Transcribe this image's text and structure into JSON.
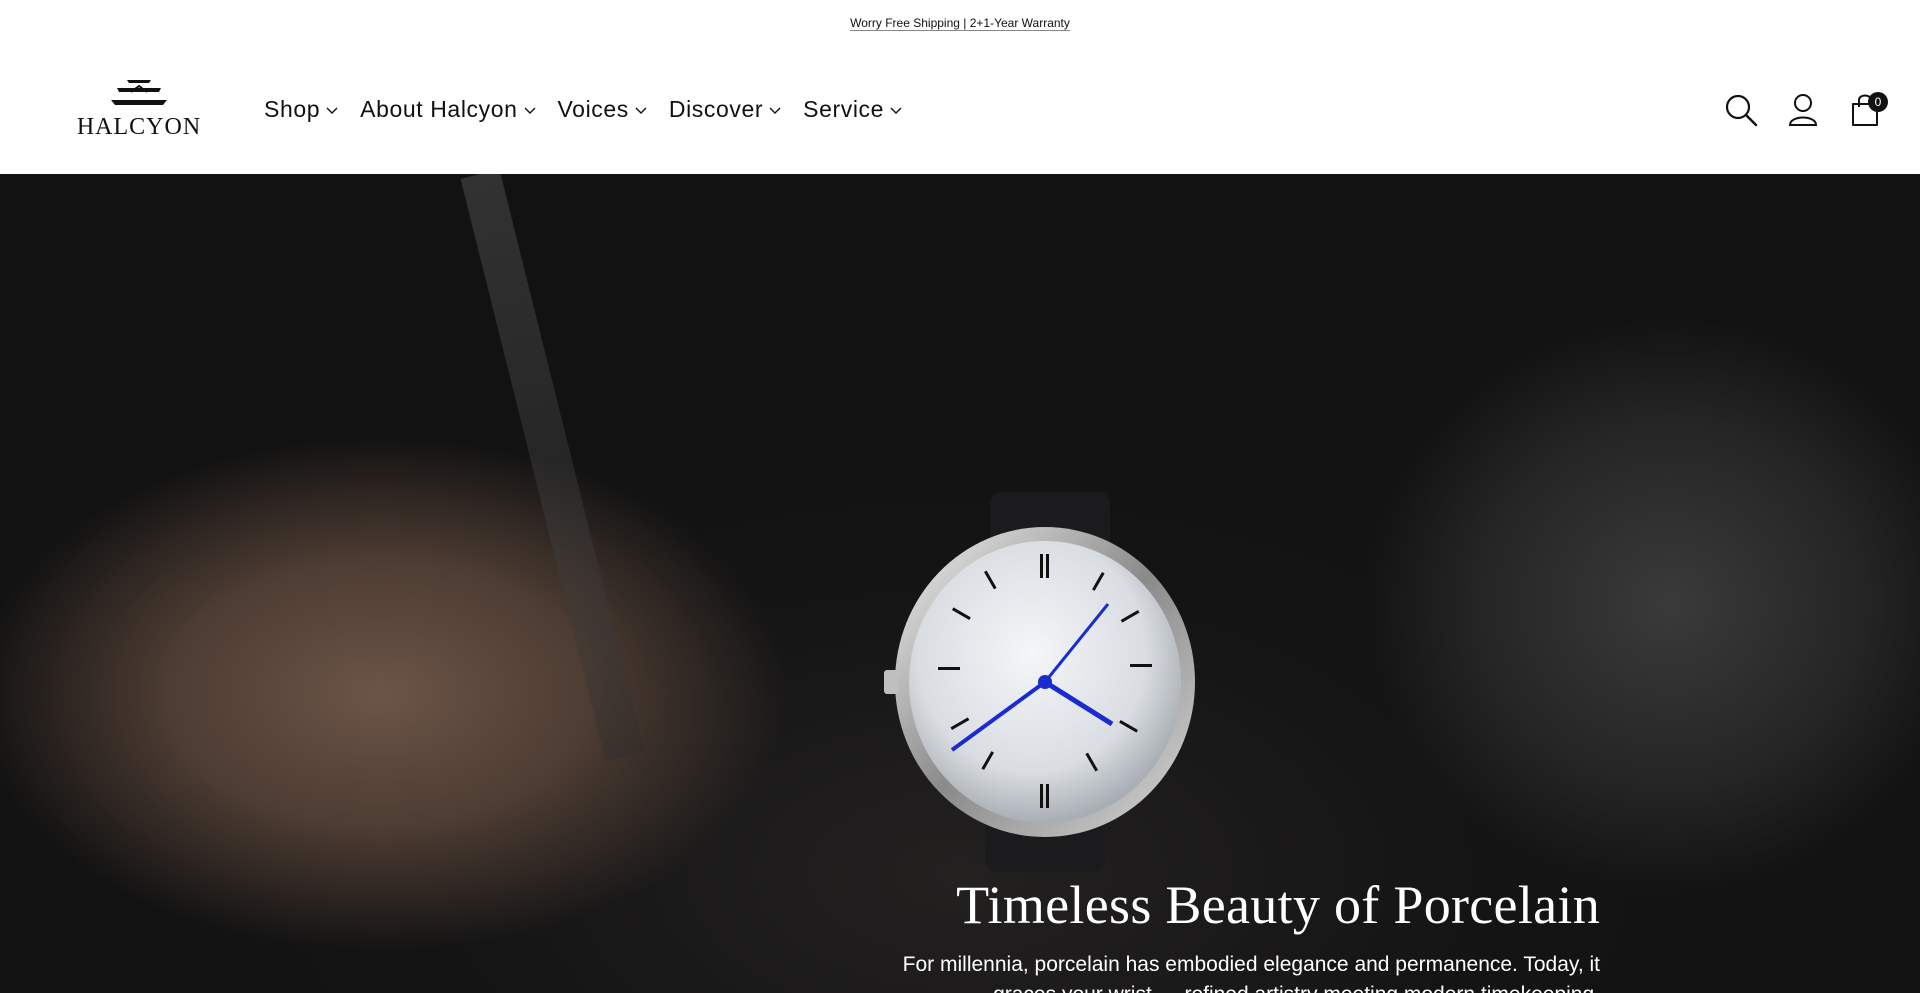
{
  "announcement": {
    "text": "Worry Free Shipping | 2+1-Year Warranty"
  },
  "brand": {
    "name": "HALCYON"
  },
  "nav": {
    "items": [
      {
        "label": "Shop"
      },
      {
        "label": "About Halcyon"
      },
      {
        "label": "Voices"
      },
      {
        "label": "Discover"
      },
      {
        "label": "Service"
      }
    ]
  },
  "header_icons": {
    "search": "search-icon",
    "account": "user-icon",
    "cart": "shopping-bag-icon",
    "cart_count": "0"
  },
  "hero": {
    "title": "Timeless Beauty of Porcelain",
    "subtitle": "For millennia, porcelain has embodied elegance and permanence. Today, it graces your wrist — refined artistry meeting modern timekeeping."
  },
  "colors": {
    "text": "#111111",
    "hero_bg": "#121212",
    "watch_hands": "#1a2bd0"
  }
}
